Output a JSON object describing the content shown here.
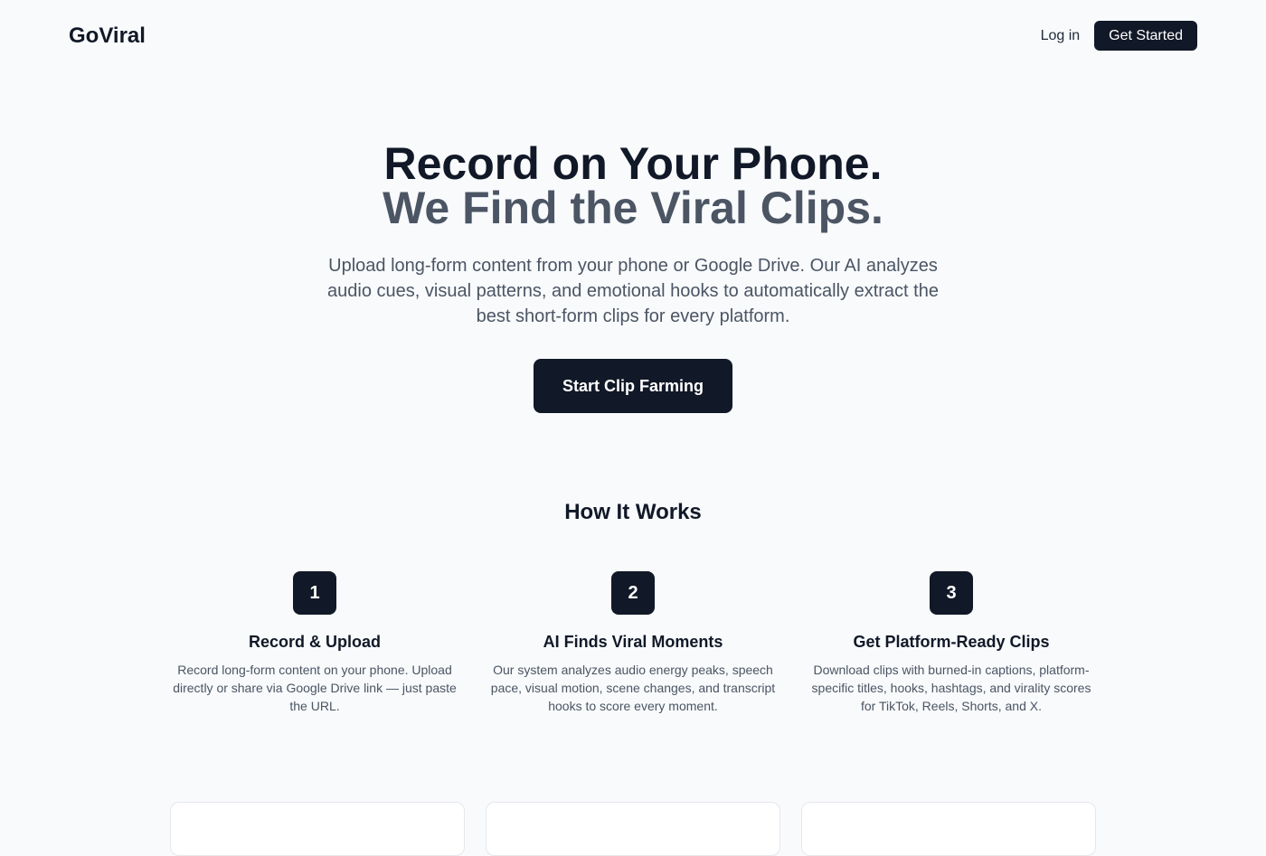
{
  "nav": {
    "logo": "GoViral",
    "login_label": "Log in",
    "get_started_label": "Get Started"
  },
  "hero": {
    "title_line1": "Record on Your Phone.",
    "title_line2": "We Find the Viral Clips.",
    "subtitle": "Upload long-form content from your phone or Google Drive. Our AI analyzes audio cues, visual patterns, and emotional hooks to automatically extract the best short-form clips for every platform.",
    "cta_label": "Start Clip Farming"
  },
  "how_it_works": {
    "title": "How It Works",
    "steps": [
      {
        "number": "1",
        "title": "Record & Upload",
        "description": "Record long-form content on your phone. Upload directly or share via Google Drive link — just paste the URL."
      },
      {
        "number": "2",
        "title": "AI Finds Viral Moments",
        "description": "Our system analyzes audio energy peaks, speech pace, visual motion, scene changes, and transcript hooks to score every moment."
      },
      {
        "number": "3",
        "title": "Get Platform-Ready Clips",
        "description": "Download clips with burned-in captions, platform-specific titles, hooks, hashtags, and virality scores for TikTok, Reels, Shorts, and X."
      }
    ]
  },
  "colors": {
    "primary": "#111827",
    "secondary_text": "#4b5563",
    "background": "#f8fafc"
  }
}
